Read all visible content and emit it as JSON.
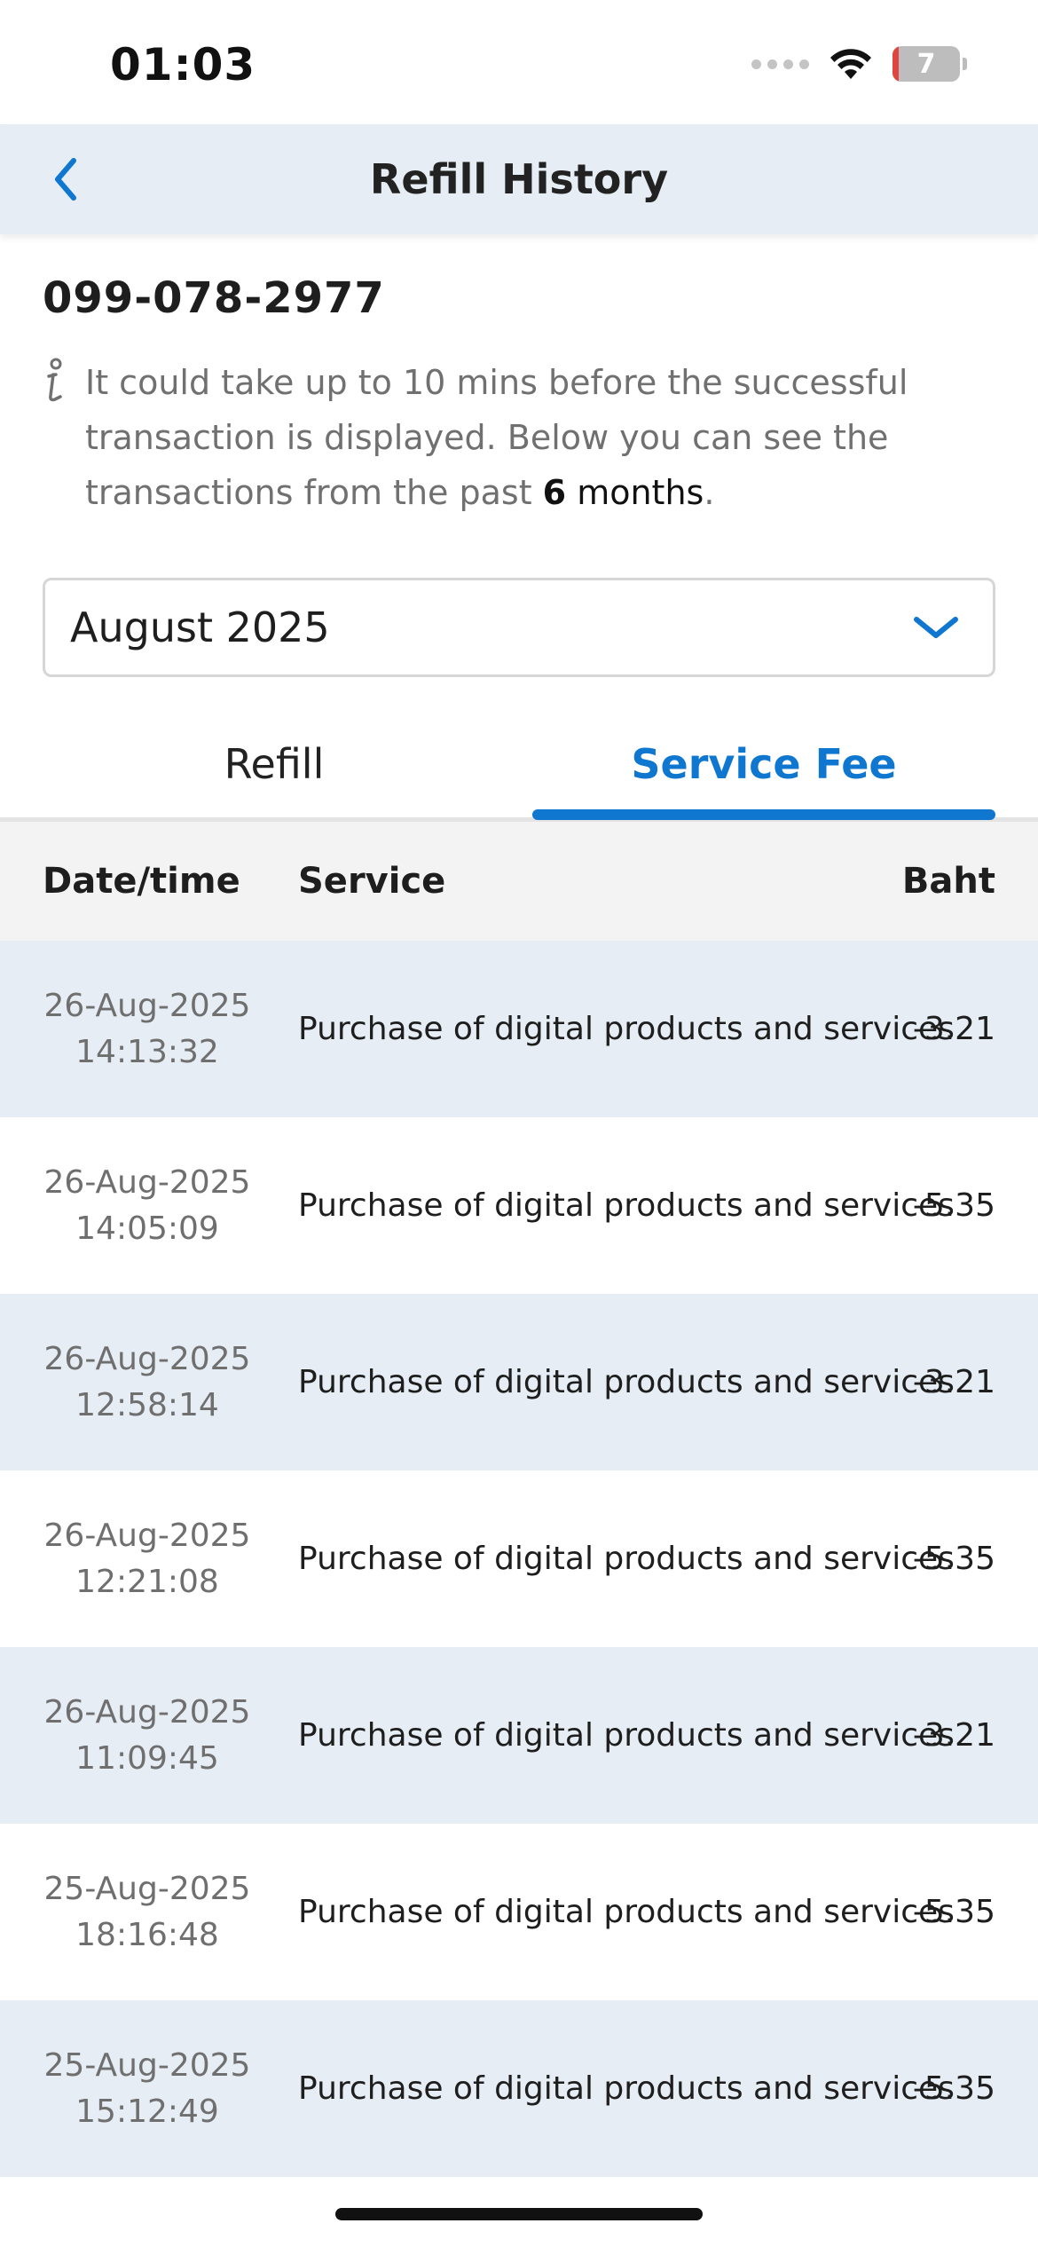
{
  "status_bar": {
    "time": "01:03",
    "battery_level": "7",
    "icons": [
      "cellular-signal-icon",
      "wifi-icon",
      "battery-icon"
    ],
    "battery_low_color": "#e0443e"
  },
  "header": {
    "title": "Refill History",
    "back_icon": "chevron-left-icon",
    "background_color": "#e6edf4"
  },
  "account": {
    "phone_number": "099-078-2977"
  },
  "info": {
    "icon": "info-icon",
    "text_before": "It could take up to 10 mins before the successful transaction is displayed. Below you can see the transactions from the past ",
    "highlight": "6",
    "text_after": " months",
    "period": "."
  },
  "month_select": {
    "value": "August 2025",
    "icon": "chevron-down-icon"
  },
  "tabs": [
    {
      "label": "Refill",
      "active": false
    },
    {
      "label": "Service Fee",
      "active": true
    }
  ],
  "accent_color": "#0f77d0",
  "table": {
    "columns": [
      "Date/time",
      "Service",
      "Baht"
    ],
    "rows": [
      {
        "date": "26-Aug-2025",
        "time": "14:13:32",
        "service": "Purchase of digital products and services",
        "amount": "-3.21"
      },
      {
        "date": "26-Aug-2025",
        "time": "14:05:09",
        "service": "Purchase of digital products and services",
        "amount": "-5.35"
      },
      {
        "date": "26-Aug-2025",
        "time": "12:58:14",
        "service": "Purchase of digital products and services",
        "amount": "-3.21"
      },
      {
        "date": "26-Aug-2025",
        "time": "12:21:08",
        "service": "Purchase of digital products and services",
        "amount": "-5.35"
      },
      {
        "date": "26-Aug-2025",
        "time": "11:09:45",
        "service": "Purchase of digital products and services",
        "amount": "-3.21"
      },
      {
        "date": "25-Aug-2025",
        "time": "18:16:48",
        "service": "Purchase of digital products and services",
        "amount": "-5.35"
      },
      {
        "date": "25-Aug-2025",
        "time": "15:12:49",
        "service": "Purchase of digital products and services",
        "amount": "-5.35"
      }
    ]
  }
}
